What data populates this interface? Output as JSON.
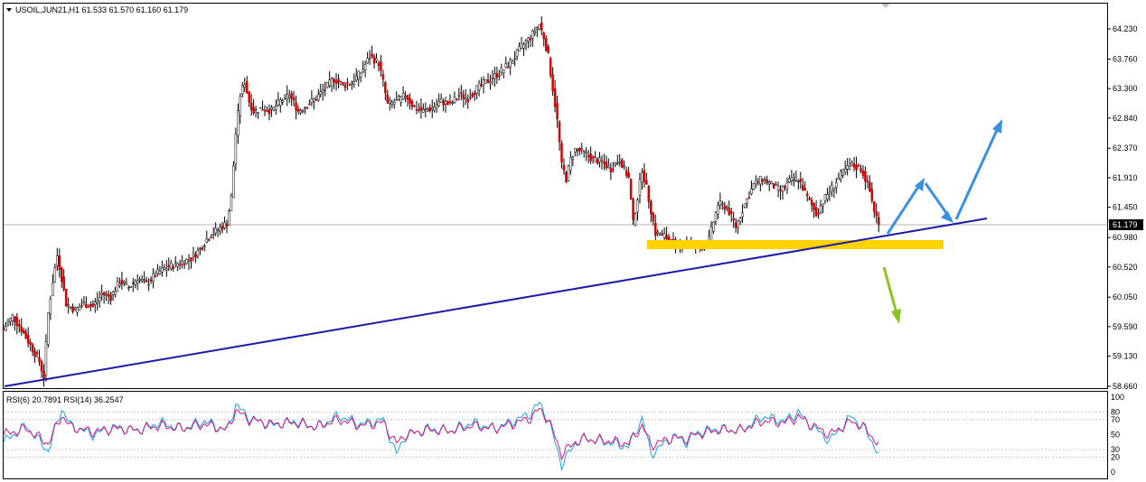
{
  "header": {
    "symbol_line": "USOIL,JUN21,H1  61.533 61.570 61.160 61.179",
    "rsi_line": "RSI(6) 20.7891  RSI(14) 36.2547"
  },
  "colors": {
    "bull": "#ffffff",
    "bear": "#d40000",
    "wick": "#000000",
    "trendline": "#1a1aa6",
    "zone": "#ffd200",
    "up_arrow": "#3a8fe0",
    "down_arrow": "#8cc41a",
    "rsi6": "#1aa3d4",
    "rsi14": "#d6148c",
    "axis_text": "#000000"
  },
  "chart_data": [
    {
      "type": "candlestick",
      "title": "USOIL,JUN21,H1",
      "timeframe": "H1",
      "last_ohlc": {
        "open": 61.533,
        "high": 61.57,
        "low": 61.16,
        "close": 61.179
      },
      "current_price_label": "61.179",
      "y_ticks": [
        "64.230",
        "63.760",
        "63.300",
        "62.840",
        "62.370",
        "61.910",
        "61.450",
        "60.980",
        "60.520",
        "60.050",
        "59.590",
        "59.130",
        "58.660"
      ],
      "ylim": [
        58.64,
        64.62
      ],
      "close_path": [
        [
          0,
          59.55
        ],
        [
          4,
          59.75
        ],
        [
          8,
          59.55
        ],
        [
          12,
          59.3
        ],
        [
          16,
          59.05
        ],
        [
          18,
          58.8
        ],
        [
          20,
          59.8
        ],
        [
          22,
          60.3
        ],
        [
          24,
          60.7
        ],
        [
          26,
          60.35
        ],
        [
          28,
          59.95
        ],
        [
          32,
          59.85
        ],
        [
          36,
          59.95
        ],
        [
          40,
          59.9
        ],
        [
          44,
          60.1
        ],
        [
          48,
          60.05
        ],
        [
          52,
          60.3
        ],
        [
          56,
          60.2
        ],
        [
          60,
          60.35
        ],
        [
          64,
          60.25
        ],
        [
          68,
          60.4
        ],
        [
          72,
          60.5
        ],
        [
          76,
          60.55
        ],
        [
          80,
          60.6
        ],
        [
          84,
          60.65
        ],
        [
          88,
          60.8
        ],
        [
          92,
          61.0
        ],
        [
          96,
          61.1
        ],
        [
          100,
          61.2
        ],
        [
          102,
          61.6
        ],
        [
          104,
          62.6
        ],
        [
          106,
          63.2
        ],
        [
          108,
          63.4
        ],
        [
          110,
          63.1
        ],
        [
          112,
          62.95
        ],
        [
          116,
          63.0
        ],
        [
          120,
          62.95
        ],
        [
          124,
          63.1
        ],
        [
          128,
          63.2
        ],
        [
          132,
          62.95
        ],
        [
          136,
          63.05
        ],
        [
          140,
          63.15
        ],
        [
          144,
          63.3
        ],
        [
          148,
          63.45
        ],
        [
          152,
          63.35
        ],
        [
          156,
          63.4
        ],
        [
          160,
          63.55
        ],
        [
          164,
          63.8
        ],
        [
          168,
          63.7
        ],
        [
          170,
          63.4
        ],
        [
          172,
          63.05
        ],
        [
          176,
          63.1
        ],
        [
          180,
          63.2
        ],
        [
          184,
          63.0
        ],
        [
          188,
          62.95
        ],
        [
          192,
          63.0
        ],
        [
          196,
          63.1
        ],
        [
          200,
          63.05
        ],
        [
          204,
          63.2
        ],
        [
          208,
          63.15
        ],
        [
          212,
          63.3
        ],
        [
          216,
          63.4
        ],
        [
          220,
          63.5
        ],
        [
          224,
          63.6
        ],
        [
          228,
          63.75
        ],
        [
          232,
          63.95
        ],
        [
          236,
          64.1
        ],
        [
          240,
          64.3
        ],
        [
          242,
          64.1
        ],
        [
          244,
          63.8
        ],
        [
          246,
          63.3
        ],
        [
          248,
          62.8
        ],
        [
          250,
          62.1
        ],
        [
          252,
          61.9
        ],
        [
          254,
          62.2
        ],
        [
          256,
          62.35
        ],
        [
          260,
          62.3
        ],
        [
          264,
          62.2
        ],
        [
          268,
          62.15
        ],
        [
          272,
          62.05
        ],
        [
          276,
          62.2
        ],
        [
          280,
          61.9
        ],
        [
          282,
          61.2
        ],
        [
          284,
          61.6
        ],
        [
          286,
          62.05
        ],
        [
          288,
          61.75
        ],
        [
          290,
          61.4
        ],
        [
          292,
          61.05
        ],
        [
          296,
          61.0
        ],
        [
          300,
          60.9
        ],
        [
          304,
          60.85
        ],
        [
          308,
          60.9
        ],
        [
          312,
          60.8
        ],
        [
          316,
          60.95
        ],
        [
          320,
          61.5
        ],
        [
          324,
          61.45
        ],
        [
          328,
          61.15
        ],
        [
          332,
          61.5
        ],
        [
          336,
          61.8
        ],
        [
          340,
          61.9
        ],
        [
          344,
          61.8
        ],
        [
          348,
          61.7
        ],
        [
          352,
          61.85
        ],
        [
          356,
          61.9
        ],
        [
          360,
          61.6
        ],
        [
          364,
          61.35
        ],
        [
          368,
          61.6
        ],
        [
          372,
          61.8
        ],
        [
          376,
          62.0
        ],
        [
          380,
          62.1
        ],
        [
          384,
          62.05
        ],
        [
          386,
          61.9
        ],
        [
          388,
          61.7
        ],
        [
          390,
          61.4
        ],
        [
          392,
          61.2
        ]
      ],
      "annotations": [
        "rising support trendline",
        "horizontal support zone",
        "projected upside path",
        "projected downside path"
      ]
    },
    {
      "type": "line",
      "title": "RSI(6) 20.7891  RSI(14) 36.2547",
      "y_ticks": [
        "100",
        "80",
        "70",
        "50",
        "30",
        "20",
        "0"
      ],
      "levels": [
        80,
        70,
        30,
        20
      ],
      "ylim": [
        0,
        100
      ],
      "series": [
        {
          "name": "RSI(6)",
          "x": [
            0,
            10,
            20,
            26,
            30,
            40,
            50,
            60,
            70,
            80,
            90,
            100,
            104,
            110,
            120,
            130,
            140,
            150,
            160,
            170,
            176,
            180,
            190,
            200,
            210,
            220,
            230,
            236,
            240,
            244,
            250,
            256,
            260,
            270,
            280,
            286,
            290,
            300,
            306,
            310,
            320,
            330,
            340,
            350,
            356,
            360,
            370,
            380,
            386,
            390,
            392
          ],
          "values": [
            40,
            62,
            28,
            85,
            62,
            50,
            60,
            55,
            66,
            58,
            68,
            55,
            90,
            72,
            62,
            68,
            60,
            75,
            64,
            70,
            24,
            48,
            58,
            55,
            66,
            58,
            70,
            78,
            92,
            70,
            10,
            38,
            45,
            40,
            34,
            72,
            24,
            48,
            40,
            52,
            58,
            55,
            74,
            68,
            80,
            66,
            42,
            75,
            56,
            36,
            22
          ]
        },
        {
          "name": "RSI(14)",
          "x": [
            0,
            10,
            20,
            26,
            30,
            40,
            50,
            60,
            70,
            80,
            90,
            100,
            104,
            110,
            120,
            130,
            140,
            150,
            160,
            170,
            176,
            180,
            190,
            200,
            210,
            220,
            230,
            236,
            240,
            244,
            250,
            256,
            260,
            270,
            280,
            286,
            290,
            300,
            306,
            310,
            320,
            330,
            340,
            350,
            356,
            360,
            370,
            380,
            386,
            390,
            392
          ],
          "values": [
            50,
            58,
            38,
            76,
            60,
            54,
            58,
            56,
            62,
            58,
            64,
            56,
            82,
            70,
            64,
            66,
            60,
            70,
            62,
            66,
            38,
            50,
            56,
            55,
            62,
            58,
            66,
            72,
            84,
            70,
            24,
            40,
            44,
            42,
            38,
            62,
            36,
            46,
            44,
            50,
            56,
            56,
            68,
            66,
            74,
            66,
            50,
            68,
            58,
            44,
            36
          ]
        }
      ]
    }
  ]
}
